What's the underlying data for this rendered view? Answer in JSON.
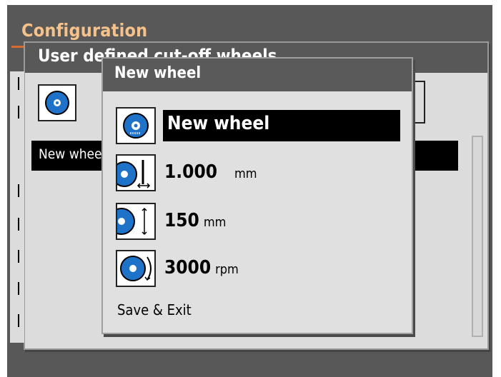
{
  "config": {
    "title": "Configuration"
  },
  "user_panel": {
    "title": "User defined cut-off wheels",
    "list_item": "New whee"
  },
  "dialog": {
    "title": "New wheel",
    "rows": [
      {
        "value": "New wheel",
        "unit": "",
        "icon": "wheel-icon"
      },
      {
        "value": "1.000",
        "unit": "mm",
        "icon": "wheel-thickness-icon"
      },
      {
        "value": "150",
        "unit": "mm",
        "icon": "wheel-diameter-icon"
      },
      {
        "value": "3000",
        "unit": "rpm",
        "icon": "wheel-speed-icon"
      }
    ],
    "save_exit": "Save & Exit"
  }
}
